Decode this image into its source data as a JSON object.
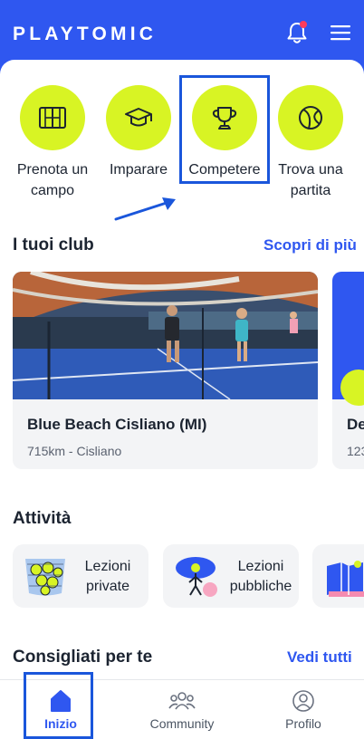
{
  "header": {
    "logo": "PLAYTOMIC"
  },
  "quick_actions": [
    {
      "label": "Prenota un campo",
      "icon": "court-icon"
    },
    {
      "label": "Imparare",
      "icon": "graduation-cap-icon"
    },
    {
      "label": "Competere",
      "icon": "trophy-icon"
    },
    {
      "label": "Trova una partita",
      "icon": "ball-icon"
    }
  ],
  "clubs": {
    "title": "I tuoi club",
    "link": "Scopri di più",
    "items": [
      {
        "name": "Blue Beach Cisliano (MI)",
        "detail": "715km - Cisliano"
      },
      {
        "name": "De",
        "detail": "123"
      }
    ]
  },
  "activities": {
    "title": "Attività",
    "items": [
      {
        "label": "Lezioni private"
      },
      {
        "label": "Lezioni pubbliche"
      }
    ]
  },
  "recommended": {
    "title": "Consigliati per te",
    "link": "Vedi tutti"
  },
  "nav": [
    {
      "label": "Inizio",
      "icon": "home-icon",
      "active": true
    },
    {
      "label": "Community",
      "icon": "community-icon",
      "active": false
    },
    {
      "label": "Profilo",
      "icon": "profile-icon",
      "active": false
    }
  ],
  "colors": {
    "brand": "#2f57f0",
    "accent": "#d8f424",
    "highlight": "#1a56db"
  }
}
